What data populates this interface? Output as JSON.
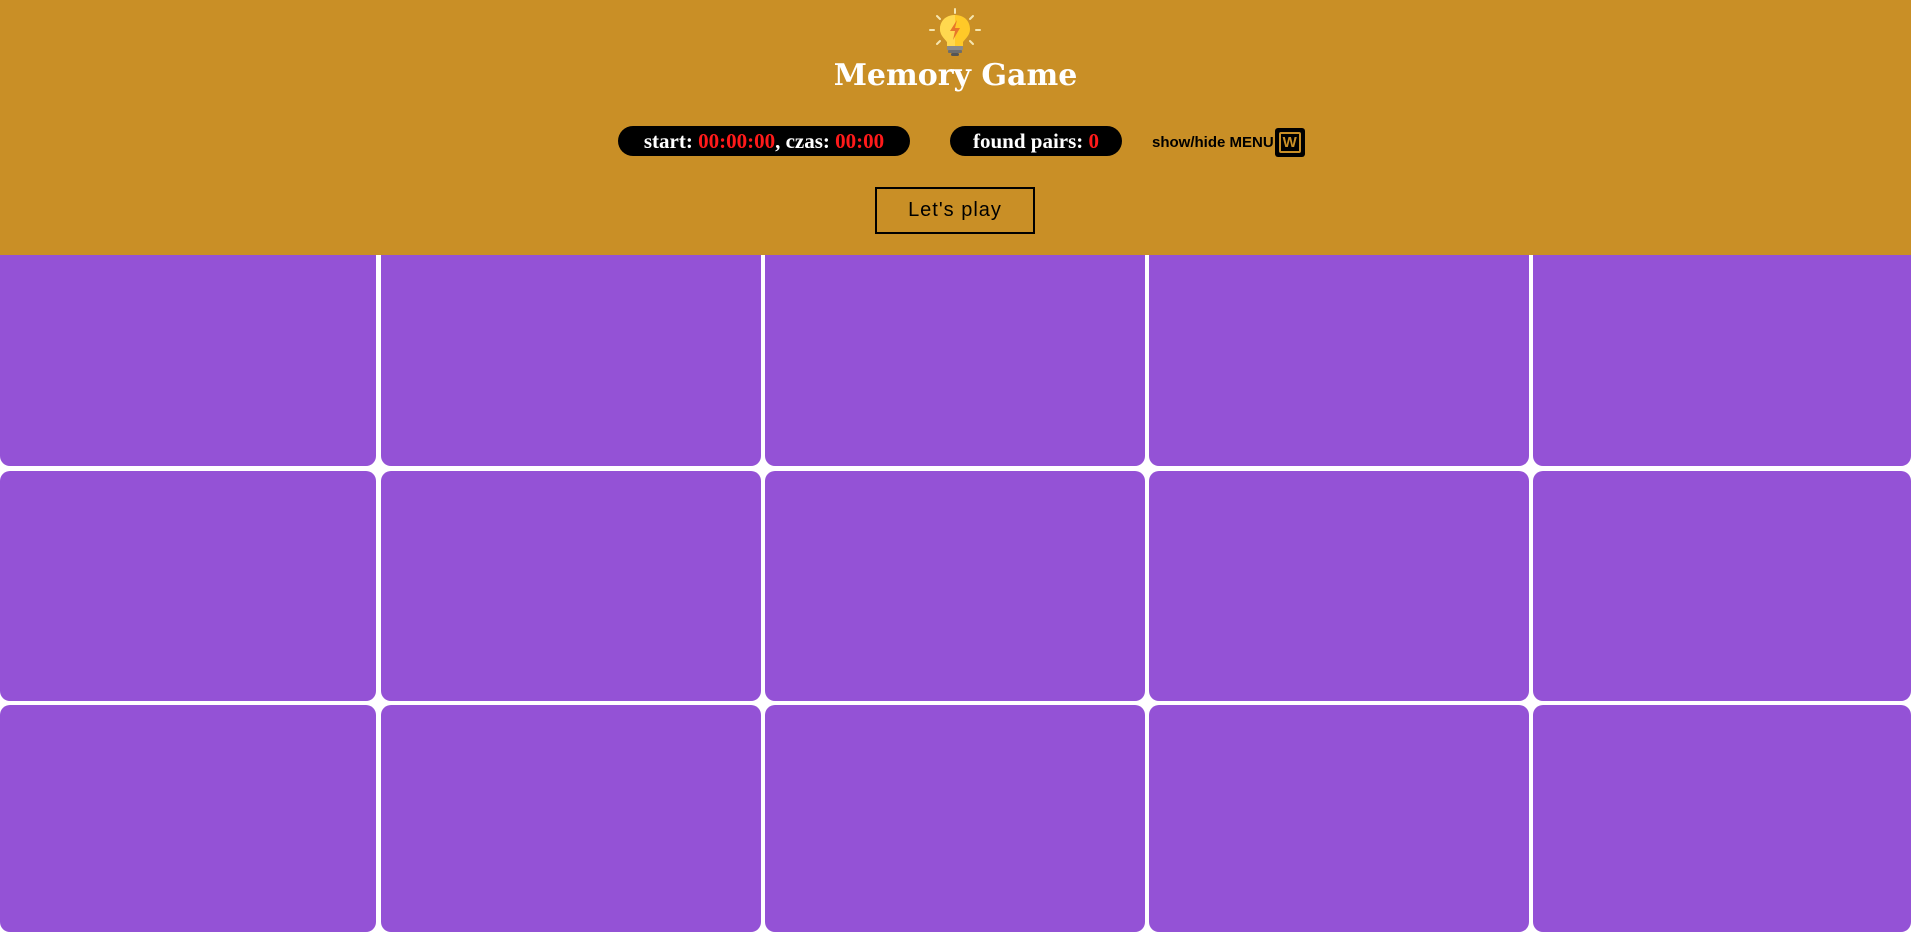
{
  "header": {
    "logo_icon": "lightbulb-icon",
    "title": "Memory Game",
    "background_color": "#c98f26"
  },
  "stats": {
    "start_label": "start: ",
    "start_time": "00:00:00",
    "elapsed_label": ", czas: ",
    "elapsed_time": "00:00",
    "pairs_label": "found pairs: ",
    "pairs_count": "0",
    "value_color": "#ff1a1a"
  },
  "menu": {
    "toggle_label": "show/hide MENU",
    "shortcut_key": "W"
  },
  "actions": {
    "play_label": "Let's play"
  },
  "board": {
    "rows": 3,
    "columns": 5,
    "card_count": 15,
    "face_down": true,
    "card_color": "#9452d6"
  }
}
